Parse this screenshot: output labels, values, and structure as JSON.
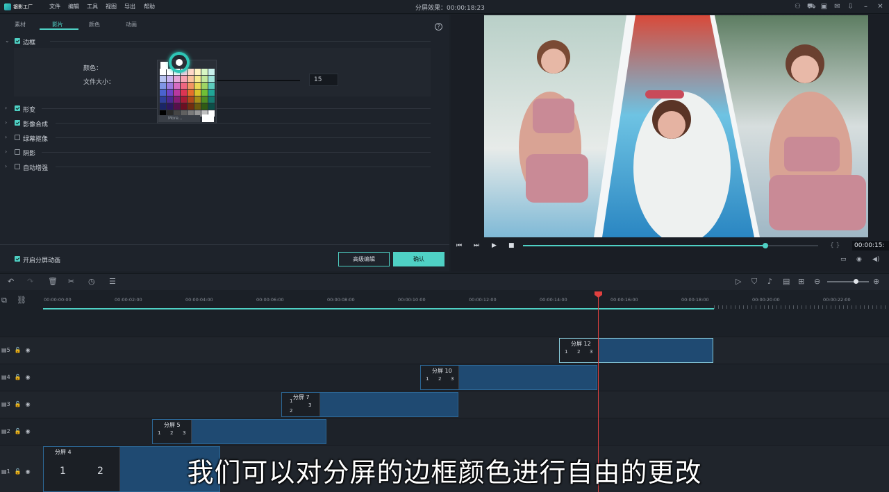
{
  "app": {
    "logo_text": "银影工厂",
    "title": "分屏效果：00:00:18:23"
  },
  "menu": [
    "文件",
    "编辑",
    "工具",
    "视图",
    "导出",
    "帮助"
  ],
  "tabs": [
    "素材",
    "影片",
    "颜色",
    "动画"
  ],
  "sections": {
    "border": "边框",
    "color_label": "颜色：",
    "size_label": "文件大小：",
    "size_value": "15",
    "transform": "形变",
    "compositing": "影像合成",
    "chroma": "绿幕抠像",
    "shadow": "阴影",
    "auto_enhance": "自动增强"
  },
  "palette": {
    "more_label": "More...",
    "colors": [
      "#ffffff",
      "#ffffff",
      "#ffffff",
      "#fbd1e3",
      "#ffd8c8",
      "#fff4c2",
      "#d7f7c4",
      "#c9f1ec",
      "#b7c3f2",
      "#c7b4f0",
      "#e7a7d8",
      "#f6a3b2",
      "#f9c19b",
      "#f5e98f",
      "#c0e79a",
      "#9ee2d8",
      "#7f95e6",
      "#9b7be0",
      "#d56cc1",
      "#ef6680",
      "#f29563",
      "#e9d957",
      "#9ed564",
      "#5ccbbc",
      "#4a63cf",
      "#6d45c6",
      "#b838a0",
      "#dc3452",
      "#e56f2b",
      "#d9c22a",
      "#6fbf36",
      "#20a596",
      "#2e3f9a",
      "#4a2a91",
      "#851c75",
      "#a61c35",
      "#b0491a",
      "#a68c18",
      "#4c8c22",
      "#14786e",
      "#1b2566",
      "#2d1861",
      "#56104c",
      "#6b1022",
      "#722e0f",
      "#6b5a0e",
      "#2f5c14",
      "#0c4e47",
      "#000000",
      "#2b2b2b",
      "#454545",
      "#606060",
      "#7b7b7b",
      "#979797",
      "#c0c0c0",
      "#ffffff"
    ]
  },
  "footer": {
    "anim_label": "开启分屏动画",
    "adv_button": "高级编辑",
    "ok_button": "确认"
  },
  "preview": {
    "timecode": "00:00:15:",
    "progress": 0.82
  },
  "ruler": [
    "00:00:00:00",
    "00:00:02:00",
    "00:00:04:00",
    "00:00:06:00",
    "00:00:08:00",
    "00:00:10:00",
    "00:00:12:00",
    "00:00:14:00",
    "00:00:16:00",
    "00:00:18:00",
    "00:00:20:00",
    "00:00:22:00"
  ],
  "tracks": [
    {
      "num": "5",
      "clip": "分屏 12",
      "n1": "1",
      "n2": "2",
      "n3": "3"
    },
    {
      "num": "4",
      "clip": "分屏 10",
      "n1": "1",
      "n2": "2",
      "n3": "3"
    },
    {
      "num": "3",
      "clip": "分屏 7",
      "n1": "1",
      "n2": "2",
      "n3": "3"
    },
    {
      "num": "2",
      "clip": "分屏 5",
      "n1": "1",
      "n2": "2",
      "n3": "3"
    },
    {
      "num": "1",
      "clip": "分屏 4",
      "n1": "1",
      "n2": "2"
    }
  ],
  "subtitle": "我们可以对分屏的边框颜色进行自由的更改"
}
